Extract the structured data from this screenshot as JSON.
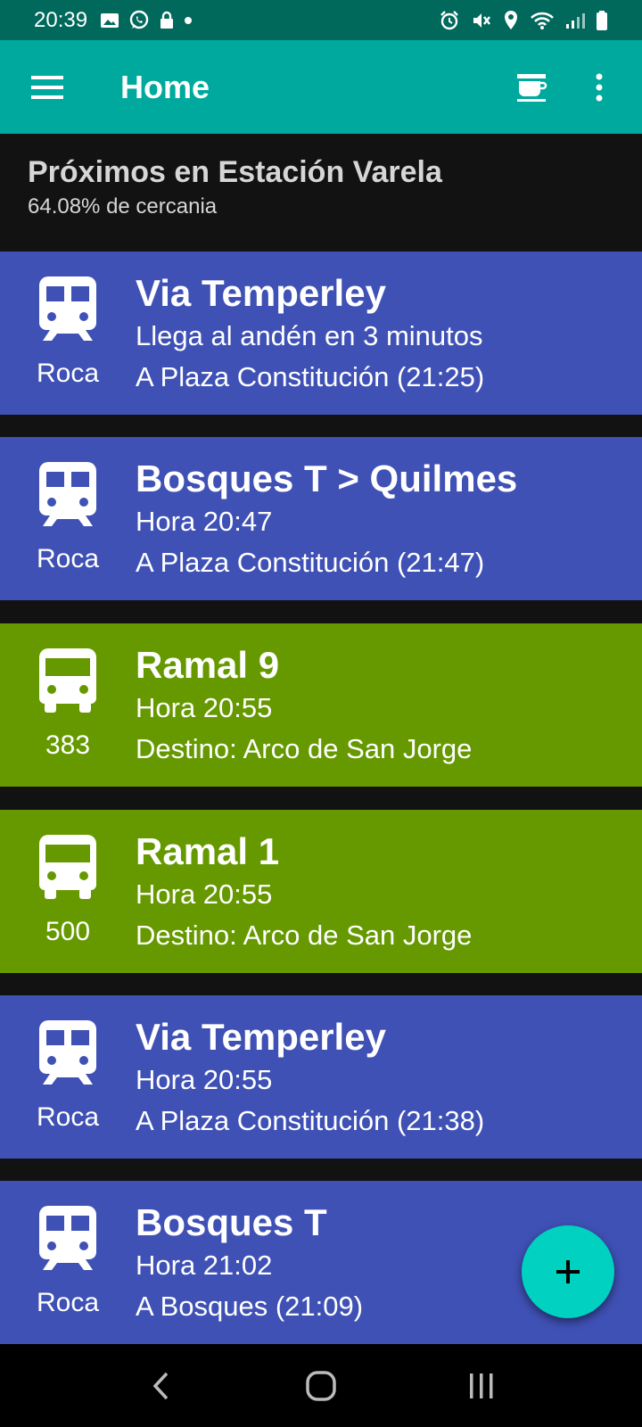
{
  "status_bar": {
    "time": "20:39",
    "left_icons": [
      "image-icon",
      "whatsapp-icon",
      "lock-icon",
      "dot-icon"
    ],
    "right_icons": [
      "alarm-icon",
      "mute-icon",
      "location-icon",
      "wifi-icon",
      "signal-icon",
      "battery-icon"
    ]
  },
  "app_bar": {
    "title": "Home",
    "background": "#00a99d"
  },
  "header": {
    "title": "Próximos en Estación Varela",
    "subtitle": "64.08% de cercania"
  },
  "arrivals": [
    {
      "kind": "train",
      "line": "Roca",
      "route": "Via Temperley",
      "detail": "Llega al andén en 3 minutos",
      "destination": "A Plaza Constitución (21:25)",
      "color": "#3f51b5"
    },
    {
      "kind": "train",
      "line": "Roca",
      "route": "Bosques T > Quilmes",
      "detail": "Hora 20:47",
      "destination": "A Plaza Constitución (21:47)",
      "color": "#3f51b5"
    },
    {
      "kind": "bus",
      "line": "383",
      "route": "Ramal 9",
      "detail": "Hora 20:55",
      "destination": "Destino: Arco de San Jorge",
      "color": "#669900"
    },
    {
      "kind": "bus",
      "line": "500",
      "route": "Ramal 1",
      "detail": "Hora 20:55",
      "destination": "Destino: Arco de San Jorge",
      "color": "#669900"
    },
    {
      "kind": "train",
      "line": "Roca",
      "route": "Via Temperley",
      "detail": "Hora 20:55",
      "destination": "A Plaza Constitución (21:38)",
      "color": "#3f51b5"
    },
    {
      "kind": "train",
      "line": "Roca",
      "route": "Bosques T",
      "detail": "Hora 21:02",
      "destination": "A Bosques (21:09)",
      "color": "#3f51b5"
    }
  ],
  "fab": {
    "icon": "plus-icon",
    "color": "#00d1c1"
  },
  "nav_bar": {
    "icons": [
      "back-icon",
      "home-icon",
      "recents-icon"
    ]
  }
}
